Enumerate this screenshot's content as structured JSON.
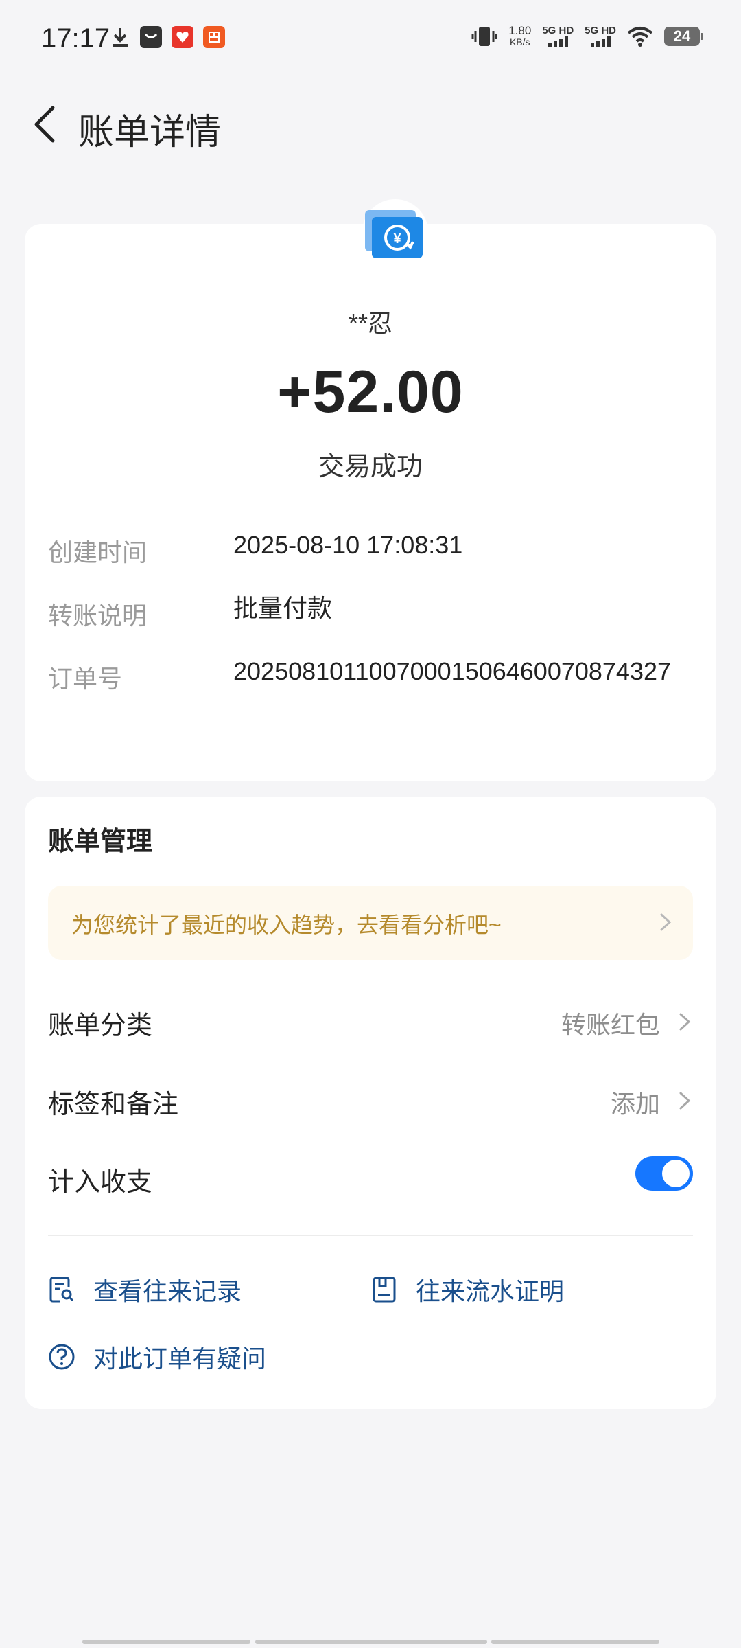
{
  "status_bar": {
    "time": "17:17",
    "net_speed_value": "1.80",
    "net_speed_unit": "KB/s",
    "signal_1": "5G HD",
    "signal_2": "5G HD",
    "battery": "24"
  },
  "header": {
    "title": "账单详情",
    "back_icon": "chevron-left-icon"
  },
  "transaction": {
    "icon": "yuan-refund-icon",
    "payee": "**忍",
    "amount": "+52.00",
    "status": "交易成功",
    "details": [
      {
        "label": "创建时间",
        "value": "2025-08-10 17:08:31"
      },
      {
        "label": "转账说明",
        "value": "批量付款"
      },
      {
        "label": "订单号",
        "value": "20250810110070001506460070874327"
      }
    ]
  },
  "management": {
    "title": "账单管理",
    "promo_text": "为您统计了最近的收入趋势，去看看分析吧~",
    "rows": [
      {
        "label": "账单分类",
        "value": "转账红包"
      },
      {
        "label": "标签和备注",
        "value": "添加"
      },
      {
        "label": "计入收支",
        "toggle_on": true
      }
    ],
    "links": [
      {
        "label": "查看往来记录",
        "icon": "record-search-icon"
      },
      {
        "label": "往来流水证明",
        "icon": "document-icon"
      },
      {
        "label": "对此订单有疑问",
        "icon": "question-circle-icon"
      }
    ]
  },
  "colors": {
    "accent": "#1677ff",
    "link": "#1a4f8c",
    "promo_text": "#b58a2c",
    "promo_bg": "#fef9ee"
  }
}
